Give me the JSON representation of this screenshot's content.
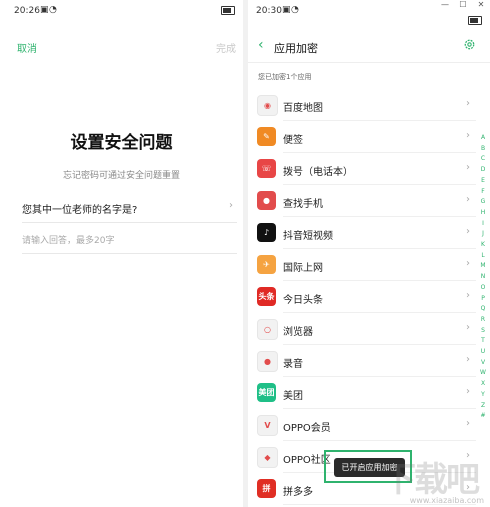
{
  "left": {
    "status": {
      "time": "20:26",
      "sim": "▣",
      "wifi": "◔"
    },
    "cancel": "取消",
    "done": "完成",
    "title": "设置安全问题",
    "subtitle": "忘记密码可通过安全问题重置",
    "question": "您其中一位老师的名字是?",
    "answer_placeholder": "请输入回答，最多20字"
  },
  "right": {
    "status": {
      "time": "20:30",
      "sim": "▣",
      "wifi": "◔"
    },
    "window_controls": {
      "minimize": "—",
      "maximize": "☐",
      "close": "✕"
    },
    "title": "应用加密",
    "encrypted_count": "您已加密1个应用",
    "apps": [
      {
        "name": "百度地图",
        "icon": "baidu-map-icon",
        "color": "#f2f2f2",
        "glyph": "◉"
      },
      {
        "name": "便签",
        "icon": "notes-icon",
        "color": "#f08a24",
        "glyph": "✎"
      },
      {
        "name": "拨号（电话本）",
        "icon": "phone-icon",
        "color": "#e84646",
        "glyph": "☏"
      },
      {
        "name": "查找手机",
        "icon": "find-phone-icon",
        "color": "#e24c4c",
        "glyph": "●"
      },
      {
        "name": "抖音短视频",
        "icon": "douyin-icon",
        "color": "#111111",
        "glyph": "♪"
      },
      {
        "name": "国际上网",
        "icon": "global-internet-icon",
        "color": "#f5a341",
        "glyph": "✈"
      },
      {
        "name": "今日头条",
        "icon": "toutiao-icon",
        "color": "#e02a25",
        "glyph": "头条"
      },
      {
        "name": "浏览器",
        "icon": "browser-icon",
        "color": "#f2f2f2",
        "glyph": "○"
      },
      {
        "name": "录音",
        "icon": "recorder-icon",
        "color": "#f2f2f2",
        "glyph": "●"
      },
      {
        "name": "美团",
        "icon": "meituan-icon",
        "color": "#1fbf87",
        "glyph": "美团"
      },
      {
        "name": "OPPO会员",
        "icon": "oppo-member-icon",
        "color": "#f2f2f2",
        "glyph": "V"
      },
      {
        "name": "OPPO社区",
        "icon": "oppo-community-icon",
        "color": "#f2f2f2",
        "glyph": "◆"
      },
      {
        "name": "拼多多",
        "icon": "pinduoduo-icon",
        "color": "#e02e24",
        "glyph": "拼"
      }
    ],
    "alphabet": [
      "A",
      "B",
      "C",
      "D",
      "E",
      "F",
      "G",
      "H",
      "I",
      "J",
      "K",
      "L",
      "M",
      "N",
      "O",
      "P",
      "Q",
      "R",
      "S",
      "T",
      "U",
      "V",
      "W",
      "X",
      "Y",
      "Z",
      "#"
    ],
    "toast": "已开启应用加密"
  },
  "watermark": {
    "text": "下载吧",
    "url": "www.xiazaiba.com"
  },
  "colors": {
    "accent": "#2fb36e"
  }
}
